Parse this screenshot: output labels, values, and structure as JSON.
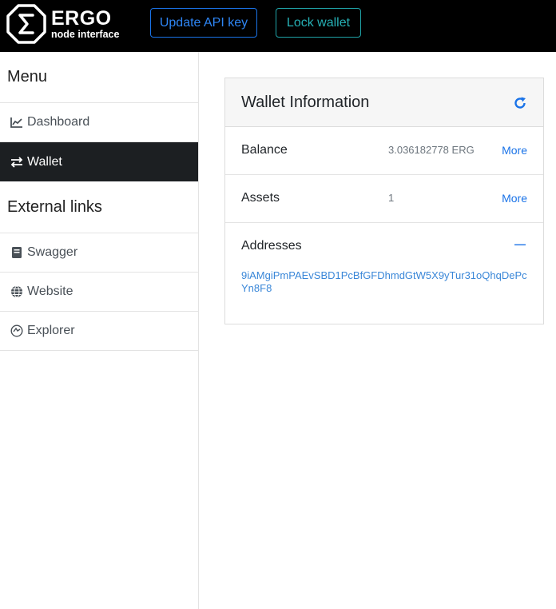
{
  "app": {
    "brand_title": "ERGO",
    "brand_subtitle": "node interface"
  },
  "topbar": {
    "update_api_label": "Update API key",
    "lock_wallet_label": "Lock wallet"
  },
  "sidebar": {
    "menu_heading": "Menu",
    "menu_items": [
      {
        "label": "Dashboard",
        "icon": "chart-line-icon"
      },
      {
        "label": "Wallet",
        "icon": "exchange-arrows-icon",
        "active": true
      }
    ],
    "external_heading": "External links",
    "external_items": [
      {
        "label": "Swagger",
        "icon": "book-icon"
      },
      {
        "label": "Website",
        "icon": "globe-icon"
      },
      {
        "label": "Explorer",
        "icon": "explorer-icon"
      }
    ]
  },
  "wallet_card": {
    "title": "Wallet Information",
    "balance_label": "Balance",
    "balance_value": "3.036182778 ERG",
    "balance_more": "More",
    "assets_label": "Assets",
    "assets_value": "1",
    "assets_more": "More",
    "addresses_label": "Addresses",
    "addresses_toggle": "—",
    "address": "9iAMgiPmPAEvSBD1PcBfGFDhmdGtW5X9yTur31oQhqDePcYn8F8"
  },
  "colors": {
    "topbar_bg": "#000000",
    "active_item_bg": "#1c1f22",
    "link_blue": "#1a73e8",
    "lock_teal": "#26b0b5"
  }
}
